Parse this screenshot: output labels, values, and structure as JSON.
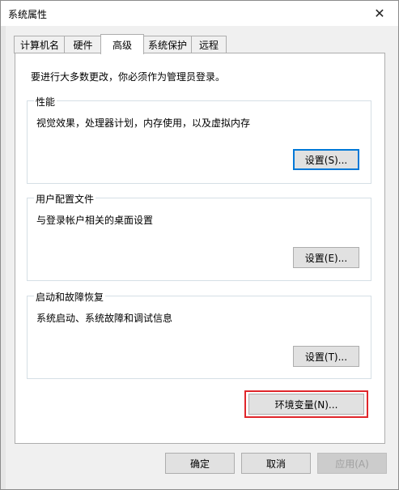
{
  "window": {
    "title": "系统属性",
    "close_glyph": "✕"
  },
  "tabs": [
    {
      "label": "计算机名",
      "active": false
    },
    {
      "label": "硬件",
      "active": false
    },
    {
      "label": "高级",
      "active": true
    },
    {
      "label": "系统保护",
      "active": false
    },
    {
      "label": "远程",
      "active": false
    }
  ],
  "notice": "要进行大多数更改，你必须作为管理员登录。",
  "performance": {
    "title": "性能",
    "description": "视觉效果，处理器计划，内存使用，以及虚拟内存",
    "button": "设置(S)..."
  },
  "user_profiles": {
    "title": "用户配置文件",
    "description": "与登录帐户相关的桌面设置",
    "button": "设置(E)..."
  },
  "startup_recovery": {
    "title": "启动和故障恢复",
    "description": "系统启动、系统故障和调试信息",
    "button": "设置(T)..."
  },
  "env_button": "环境变量(N)...",
  "footer": {
    "ok": "确定",
    "cancel": "取消",
    "apply": "应用(A)"
  },
  "colors": {
    "highlight": "#e0262b",
    "focus": "#0078d7"
  }
}
